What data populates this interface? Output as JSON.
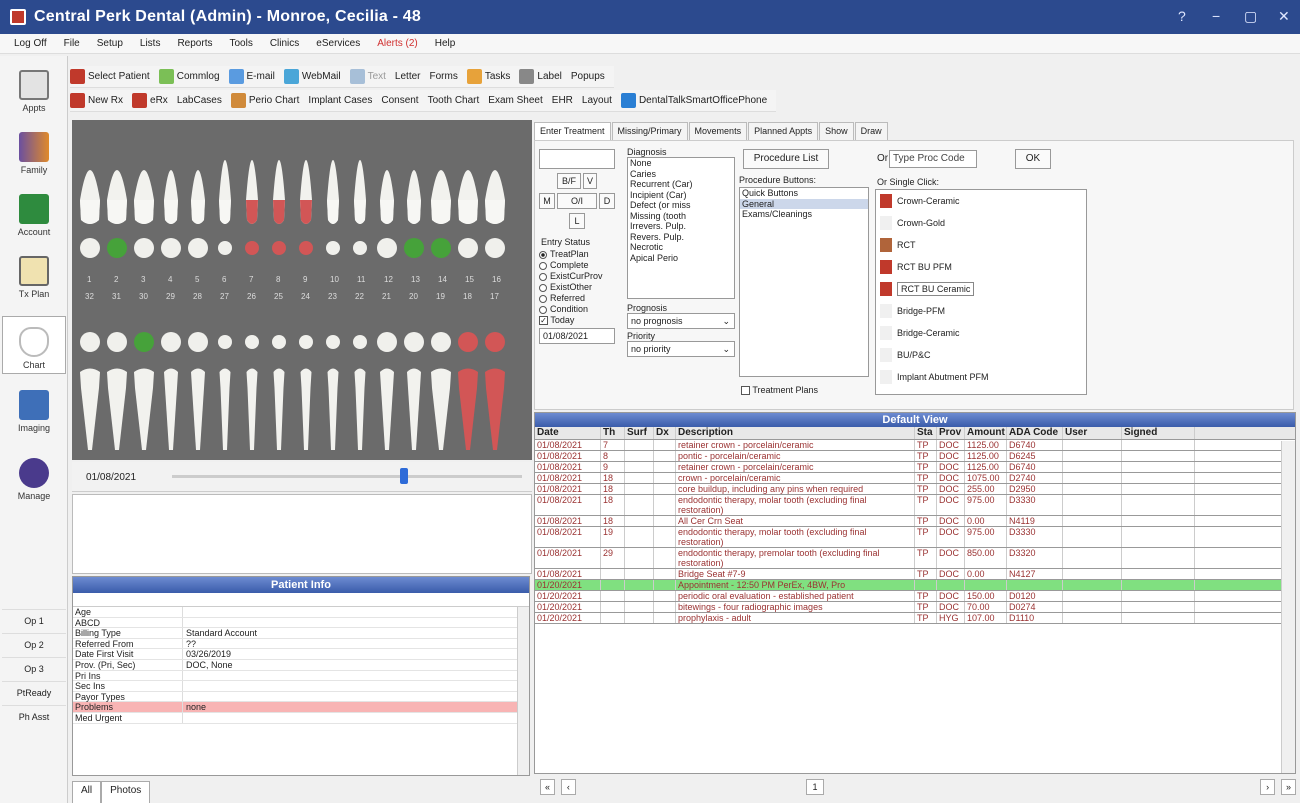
{
  "title": "Central Perk Dental (Admin) - Monroe, Cecilia - 48",
  "window_controls": [
    "?",
    "−",
    "▢",
    "✕"
  ],
  "menu": [
    "Log Off",
    "File",
    "Setup",
    "Lists",
    "Reports",
    "Tools",
    "Clinics",
    "eServices",
    "Alerts (2)",
    "Help"
  ],
  "toolbar1": [
    "Select Patient",
    "Commlog",
    "E-mail",
    "WebMail",
    "Text",
    "Letter",
    "Forms",
    "Tasks",
    "Label",
    "Popups"
  ],
  "toolbar2": [
    "New Rx",
    "eRx",
    "LabCases",
    "Perio Chart",
    "Implant Cases",
    "Consent",
    "Tooth Chart",
    "Exam Sheet",
    "EHR",
    "Layout",
    "DentalTalkSmartOfficePhone"
  ],
  "nav": [
    "Appts",
    "Family",
    "Account",
    "Tx Plan",
    "Chart",
    "Imaging",
    "Manage"
  ],
  "ops": [
    "Op 1",
    "Op 2",
    "Op 3",
    "PtReady",
    "Ph Asst"
  ],
  "upper_nums": [
    "1",
    "2",
    "3",
    "4",
    "5",
    "6",
    "7",
    "8",
    "9",
    "10",
    "11",
    "12",
    "13",
    "14",
    "15",
    "16"
  ],
  "lower_nums": [
    "32",
    "31",
    "30",
    "29",
    "28",
    "27",
    "26",
    "25",
    "24",
    "23",
    "22",
    "21",
    "20",
    "19",
    "18",
    "17"
  ],
  "chart_date": "01/08/2021",
  "patient_info": {
    "header": "Patient Info",
    "rows": [
      {
        "k": "Age",
        "v": ""
      },
      {
        "k": "ABCD",
        "v": ""
      },
      {
        "k": "Billing Type",
        "v": "Standard Account"
      },
      {
        "k": "Referred From",
        "v": "??"
      },
      {
        "k": "Date First Visit",
        "v": "03/26/2019"
      },
      {
        "k": "Prov. (Pri, Sec)",
        "v": "DOC, None"
      },
      {
        "k": "Pri Ins",
        "v": ""
      },
      {
        "k": "Sec Ins",
        "v": ""
      },
      {
        "k": "Payor Types",
        "v": ""
      },
      {
        "k": "Problems",
        "v": "none"
      },
      {
        "k": "Med Urgent",
        "v": ""
      }
    ]
  },
  "bottom_tabs": [
    "All",
    "Photos"
  ],
  "right_tabs": [
    "Enter Treatment",
    "Missing/Primary",
    "Movements",
    "Planned Appts",
    "Show",
    "Draw"
  ],
  "surf_buttons": [
    "B/F",
    "V",
    "M",
    "O/I",
    "D",
    "L"
  ],
  "entry_status_label": "Entry Status",
  "entry_status": [
    "TreatPlan",
    "Complete",
    "ExistCurProv",
    "ExistOther",
    "Referred",
    "Condition"
  ],
  "today_label": "Today",
  "date_field": "01/08/2021",
  "diagnosis_label": "Diagnosis",
  "diagnoses": [
    "None",
    "Caries",
    "Recurrent (Car)",
    "Incipient (Car)",
    "Defect (or miss",
    "Missing (tooth",
    "Irrevers. Pulp.",
    "Revers. Pulp.",
    "Necrotic",
    "Apical Perio"
  ],
  "prognosis_label": "Prognosis",
  "prognosis_value": "no prognosis",
  "priority_label": "Priority",
  "priority_value": "no priority",
  "procedure_list_btn": "Procedure List",
  "proc_buttons_label": "Procedure Buttons:",
  "proc_buttons": [
    "Quick Buttons",
    "General",
    "Exams/Cleanings"
  ],
  "treatment_plans": "Treatment Plans",
  "or_type": "Or",
  "proc_code_placeholder": "Type Proc Code",
  "ok": "OK",
  "single_click": "Or Single Click:",
  "procedures": [
    "Crown-Ceramic",
    "Crown-Gold",
    "RCT",
    "RCT BU PFM",
    "RCT BU Ceramic",
    "Bridge-PFM",
    "Bridge-Ceramic",
    "BU/P&C",
    "Implant Abutment PFM"
  ],
  "grid": {
    "title": "Default View",
    "cols": [
      "Date",
      "Th",
      "Surf",
      "Dx",
      "Description",
      "Sta",
      "Prov",
      "Amount",
      "ADA Code",
      "User",
      "Signed"
    ],
    "rows": [
      {
        "date": "01/08/2021",
        "th": "7",
        "surf": "",
        "dx": "",
        "desc": "retainer crown - porcelain/ceramic",
        "sta": "TP",
        "prov": "DOC",
        "amt": "1125.00",
        "code": "D6740",
        "green": false
      },
      {
        "date": "01/08/2021",
        "th": "8",
        "surf": "",
        "dx": "",
        "desc": "pontic - porcelain/ceramic",
        "sta": "TP",
        "prov": "DOC",
        "amt": "1125.00",
        "code": "D6245",
        "green": false
      },
      {
        "date": "01/08/2021",
        "th": "9",
        "surf": "",
        "dx": "",
        "desc": "retainer crown - porcelain/ceramic",
        "sta": "TP",
        "prov": "DOC",
        "amt": "1125.00",
        "code": "D6740",
        "green": false
      },
      {
        "date": "01/08/2021",
        "th": "18",
        "surf": "",
        "dx": "",
        "desc": "crown - porcelain/ceramic",
        "sta": "TP",
        "prov": "DOC",
        "amt": "1075.00",
        "code": "D2740",
        "green": false
      },
      {
        "date": "01/08/2021",
        "th": "18",
        "surf": "",
        "dx": "",
        "desc": "core buildup, including any pins when required",
        "sta": "TP",
        "prov": "DOC",
        "amt": "255.00",
        "code": "D2950",
        "green": false
      },
      {
        "date": "01/08/2021",
        "th": "18",
        "surf": "",
        "dx": "",
        "desc": "endodontic therapy, molar tooth (excluding final restoration)",
        "sta": "TP",
        "prov": "DOC",
        "amt": "975.00",
        "code": "D3330",
        "green": false
      },
      {
        "date": "01/08/2021",
        "th": "18",
        "surf": "",
        "dx": "",
        "desc": "All Cer Crn Seat",
        "sta": "TP",
        "prov": "DOC",
        "amt": "0.00",
        "code": "N4119",
        "green": false
      },
      {
        "date": "01/08/2021",
        "th": "19",
        "surf": "",
        "dx": "",
        "desc": "endodontic therapy, molar tooth (excluding final restoration)",
        "sta": "TP",
        "prov": "DOC",
        "amt": "975.00",
        "code": "D3330",
        "green": false
      },
      {
        "date": "01/08/2021",
        "th": "29",
        "surf": "",
        "dx": "",
        "desc": "endodontic therapy, premolar tooth (excluding final restoration)",
        "sta": "TP",
        "prov": "DOC",
        "amt": "850.00",
        "code": "D3320",
        "green": false
      },
      {
        "date": "01/08/2021",
        "th": "",
        "surf": "",
        "dx": "",
        "desc": "Bridge Seat #7-9",
        "sta": "TP",
        "prov": "DOC",
        "amt": "0.00",
        "code": "N4127",
        "green": false
      },
      {
        "date": "01/20/2021",
        "th": "",
        "surf": "",
        "dx": "",
        "desc": "Appointment - 12:50 PM PerEx, 4BW, Pro",
        "sta": "",
        "prov": "",
        "amt": "",
        "code": "",
        "green": true
      },
      {
        "date": "01/20/2021",
        "th": "",
        "surf": "",
        "dx": "",
        "desc": "periodic oral evaluation - established patient",
        "sta": "TP",
        "prov": "DOC",
        "amt": "150.00",
        "code": "D0120",
        "green": false
      },
      {
        "date": "01/20/2021",
        "th": "",
        "surf": "",
        "dx": "",
        "desc": "bitewings - four radiographic images",
        "sta": "TP",
        "prov": "DOC",
        "amt": "70.00",
        "code": "D0274",
        "green": false
      },
      {
        "date": "01/20/2021",
        "th": "",
        "surf": "",
        "dx": "",
        "desc": "prophylaxis - adult",
        "sta": "TP",
        "prov": "HYG",
        "amt": "107.00",
        "code": "D1110",
        "green": false
      }
    ]
  },
  "page_number": "1"
}
